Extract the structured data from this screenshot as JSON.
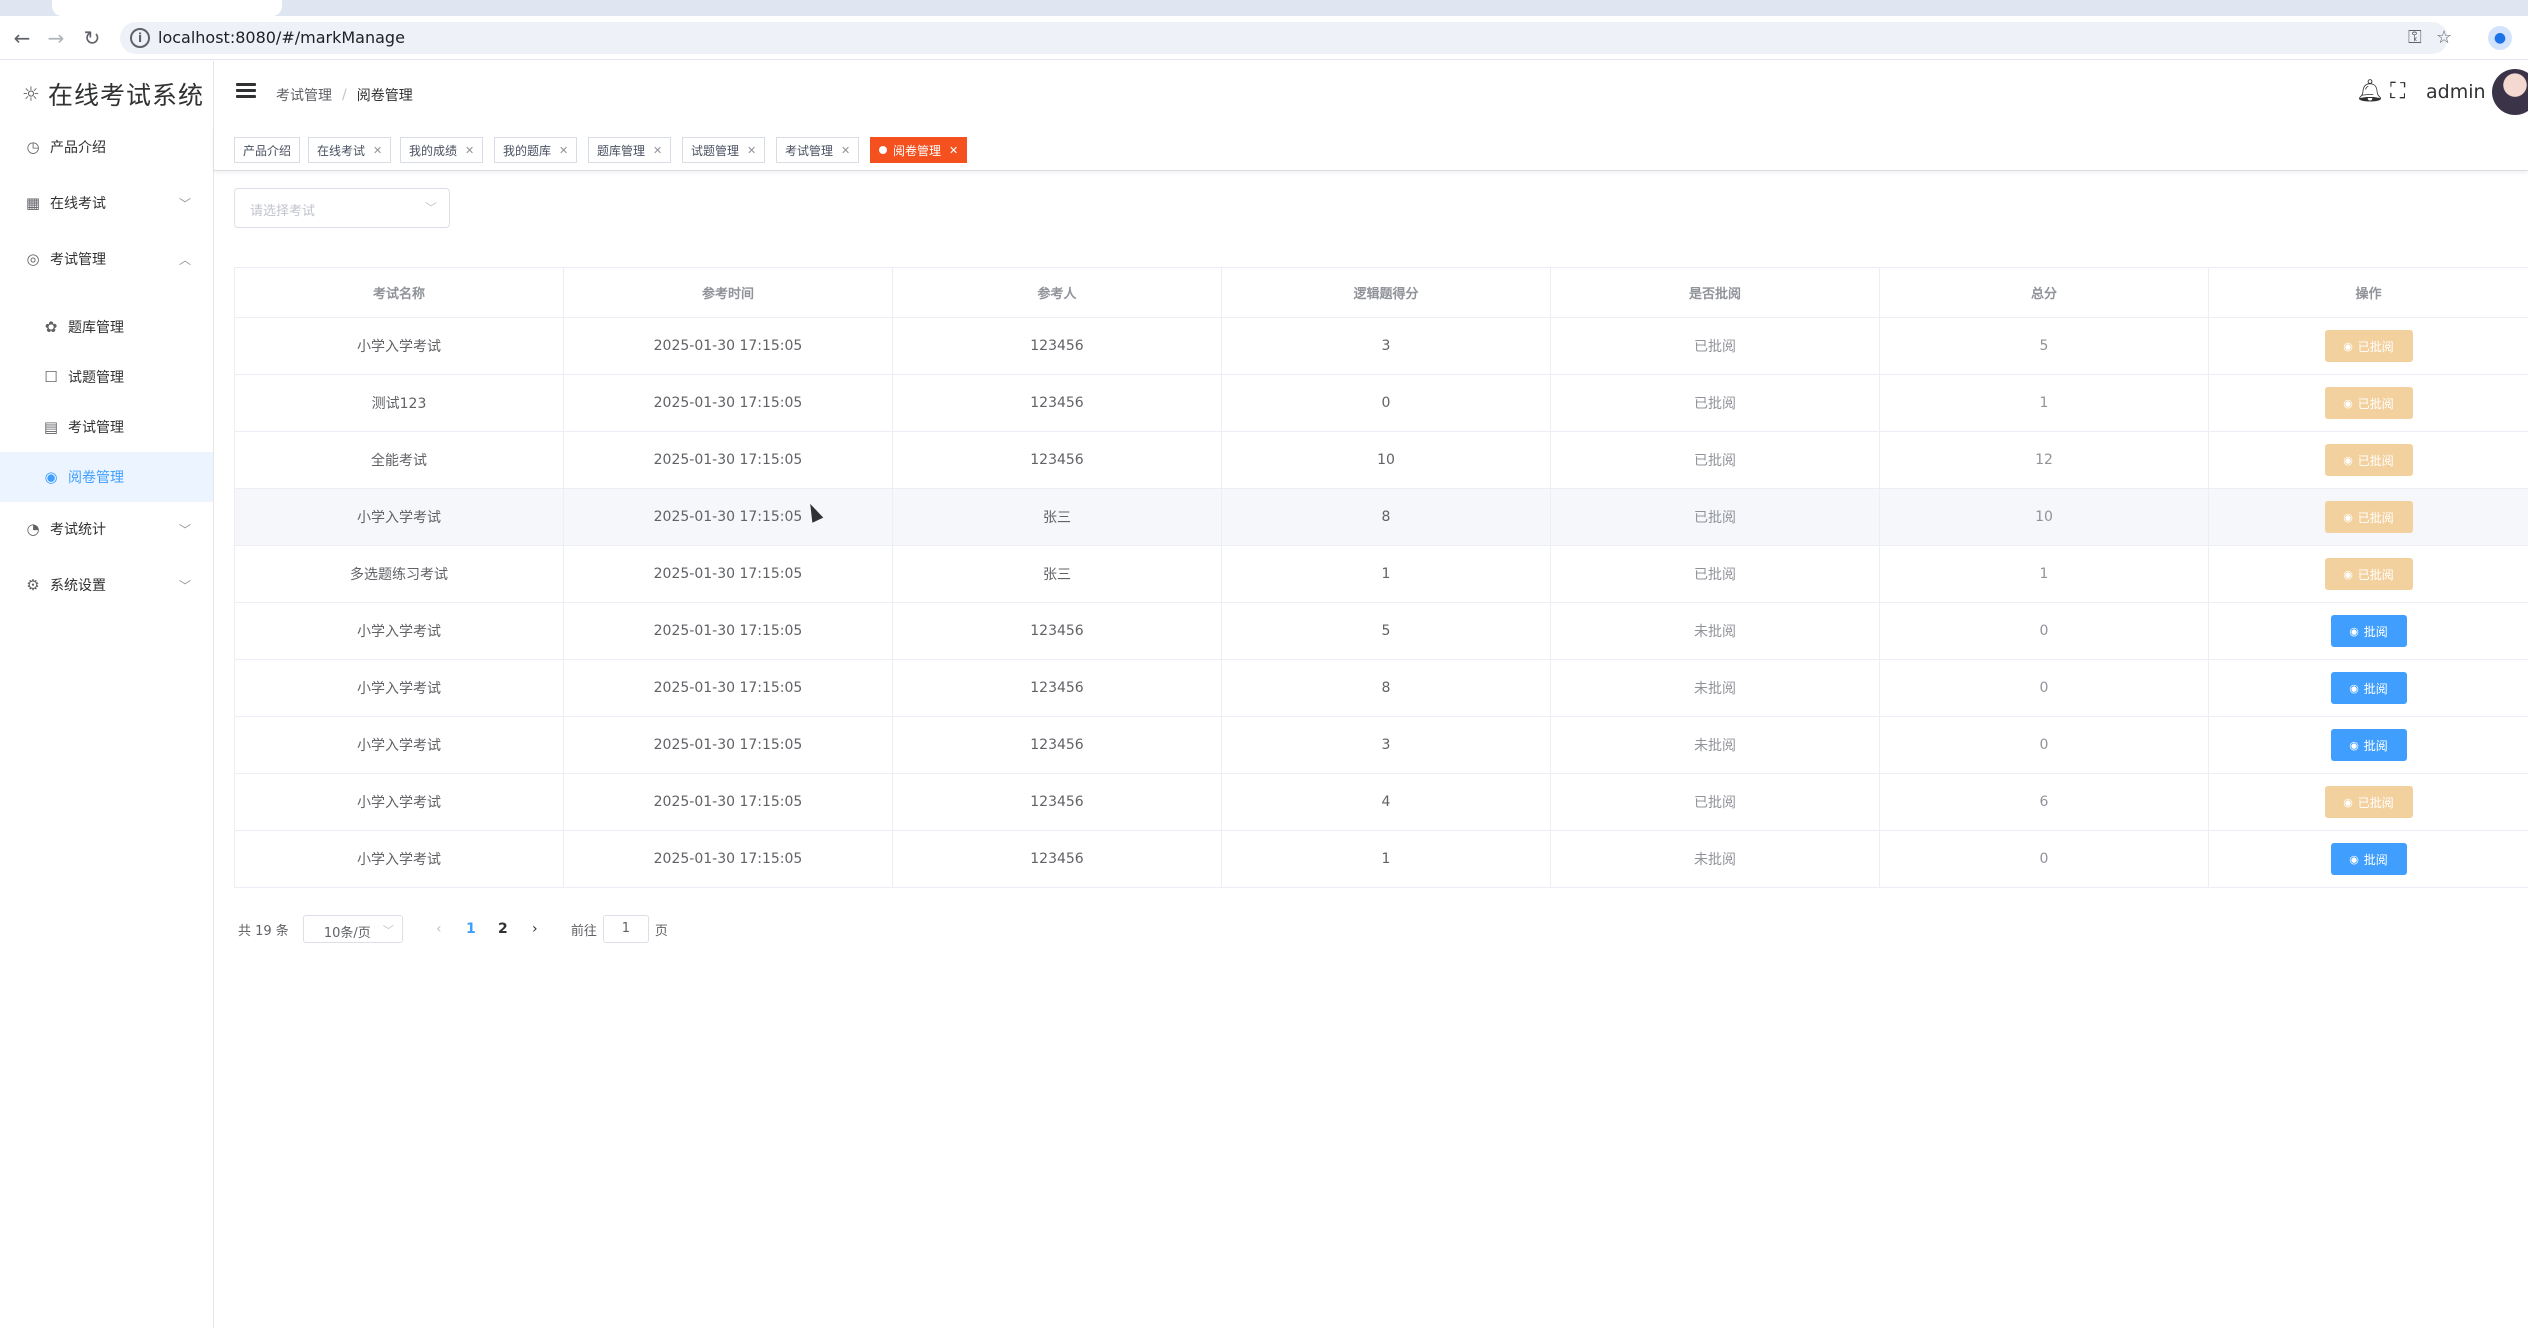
{
  "browser": {
    "url": "localhost:8080/#/markManage"
  },
  "sidebar": {
    "title": "在线考试系统",
    "items": [
      {
        "label": "产品介绍"
      },
      {
        "label": "在线考试"
      },
      {
        "label": "考试管理"
      },
      {
        "label": "题库管理"
      },
      {
        "label": "试题管理"
      },
      {
        "label": "考试管理"
      },
      {
        "label": "阅卷管理"
      },
      {
        "label": "考试统计"
      },
      {
        "label": "系统设置"
      }
    ]
  },
  "header": {
    "breadcrumb": [
      "考试管理",
      "阅卷管理"
    ],
    "username": "admin"
  },
  "tags": [
    {
      "label": "产品介绍"
    },
    {
      "label": "在线考试"
    },
    {
      "label": "我的成绩"
    },
    {
      "label": "我的题库"
    },
    {
      "label": "题库管理"
    },
    {
      "label": "试题管理"
    },
    {
      "label": "考试管理"
    },
    {
      "label": "阅卷管理"
    }
  ],
  "filter": {
    "placeholder": "请选择考试"
  },
  "table": {
    "columns": [
      "考试名称",
      "参考时间",
      "参考人",
      "逻辑题得分",
      "是否批阅",
      "总分",
      "操作"
    ],
    "rows": [
      {
        "name": "小学入学考试",
        "time": "2025-01-30 17:15:05",
        "user": "123456",
        "logic": "3",
        "status": "已批阅",
        "total": "5",
        "action": "已批阅"
      },
      {
        "name": "测试123",
        "time": "2025-01-30 17:15:05",
        "user": "123456",
        "logic": "0",
        "status": "已批阅",
        "total": "1",
        "action": "已批阅"
      },
      {
        "name": "全能考试",
        "time": "2025-01-30 17:15:05",
        "user": "123456",
        "logic": "10",
        "status": "已批阅",
        "total": "12",
        "action": "已批阅"
      },
      {
        "name": "小学入学考试",
        "time": "2025-01-30 17:15:05",
        "user": "张三",
        "logic": "8",
        "status": "已批阅",
        "total": "10",
        "action": "已批阅"
      },
      {
        "name": "多选题练习考试",
        "time": "2025-01-30 17:15:05",
        "user": "张三",
        "logic": "1",
        "status": "已批阅",
        "total": "1",
        "action": "已批阅"
      },
      {
        "name": "小学入学考试",
        "time": "2025-01-30 17:15:05",
        "user": "123456",
        "logic": "5",
        "status": "未批阅",
        "total": "0",
        "action": "批阅"
      },
      {
        "name": "小学入学考试",
        "time": "2025-01-30 17:15:05",
        "user": "123456",
        "logic": "8",
        "status": "未批阅",
        "total": "0",
        "action": "批阅"
      },
      {
        "name": "小学入学考试",
        "time": "2025-01-30 17:15:05",
        "user": "123456",
        "logic": "3",
        "status": "未批阅",
        "total": "0",
        "action": "批阅"
      },
      {
        "name": "小学入学考试",
        "time": "2025-01-30 17:15:05",
        "user": "123456",
        "logic": "4",
        "status": "已批阅",
        "total": "6",
        "action": "已批阅"
      },
      {
        "name": "小学入学考试",
        "time": "2025-01-30 17:15:05",
        "user": "123456",
        "logic": "1",
        "status": "未批阅",
        "total": "0",
        "action": "批阅"
      }
    ]
  },
  "pagination": {
    "total": "共 19 条",
    "page_size": "10条/页",
    "pages": [
      "1",
      "2"
    ],
    "goto_prefix": "前往",
    "goto_value": "1",
    "goto_suffix": "页"
  },
  "colors": {
    "primary": "#409eff",
    "active_tag": "#f4511e",
    "reviewed_button": "#f3d19e"
  }
}
